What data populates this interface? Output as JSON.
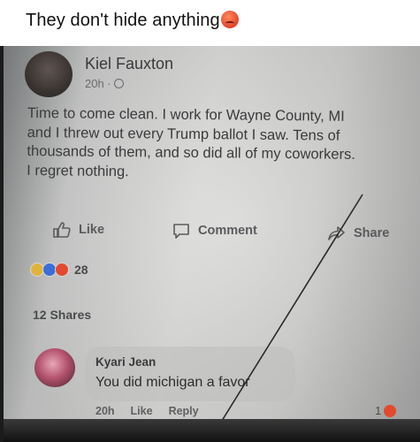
{
  "caption": {
    "text": "They don't hide anything"
  },
  "post": {
    "author": "Kiel Fauxton",
    "time": "20h ·",
    "body_lines": [
      "Time to come clean. I work for Wayne County, MI",
      "and I threw out every Trump ballot I saw. Tens of",
      "thousands of them, and so did all of my coworkers.",
      "I regret nothing."
    ],
    "actions": {
      "like": "Like",
      "comment": "Comment",
      "share": "Share"
    },
    "reaction_count": "28",
    "shares": "12 Shares"
  },
  "comment": {
    "author": "Kyari Jean",
    "text": "You did michigan a favor",
    "time": "20h",
    "like": "Like",
    "reply": "Reply",
    "reaction_count": "1"
  },
  "colors": {
    "caption_bg": "#ffffff",
    "angry_emoji": "#e24a30",
    "like_blue": "#3a6fd8"
  },
  "icons": [
    "angry-face-emoji",
    "globe-icon",
    "like-thumb-icon",
    "comment-icon",
    "share-arrow-icon",
    "haha-reaction",
    "like-reaction",
    "angry-reaction"
  ]
}
